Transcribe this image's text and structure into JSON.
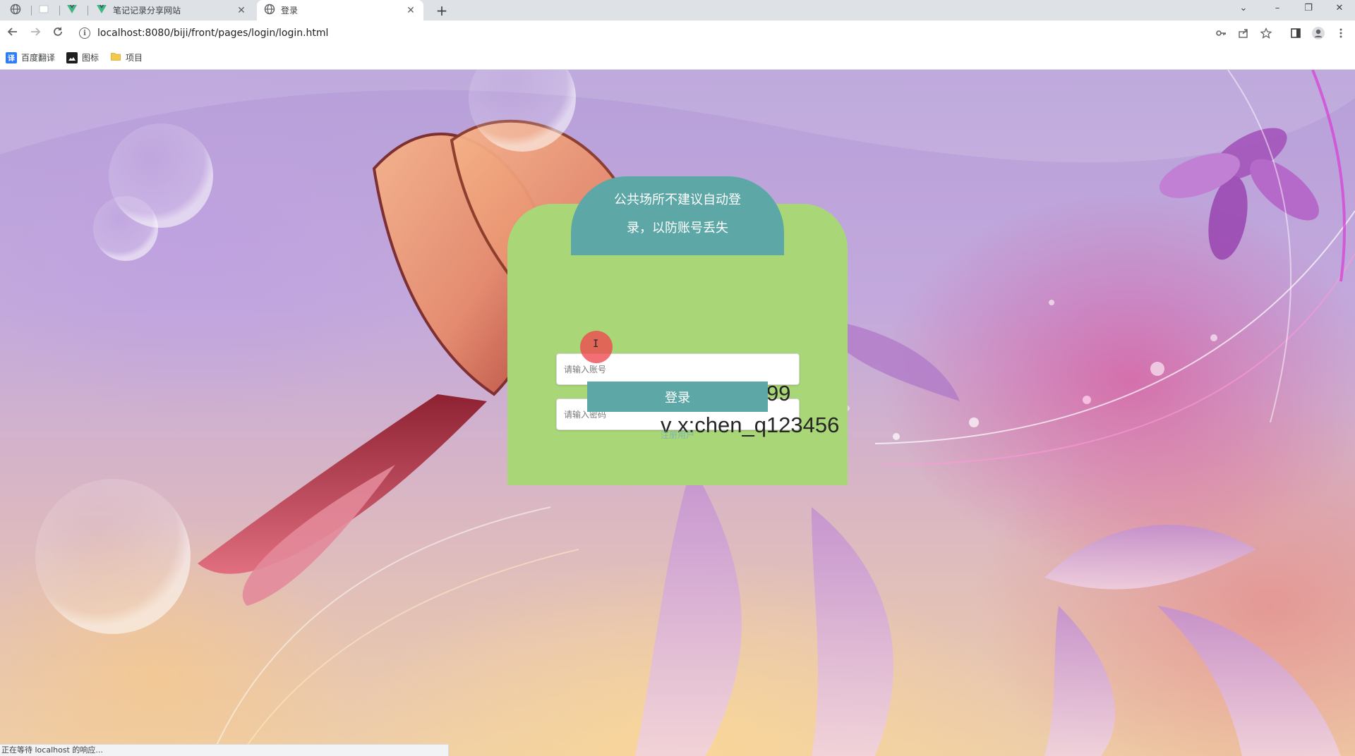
{
  "browser": {
    "tabs": [
      {
        "title": "",
        "icon": "globe-icon"
      },
      {
        "title": "",
        "icon": "blank-page-icon"
      },
      {
        "title": "",
        "icon": "vue-logo-icon"
      },
      {
        "title": "笔记记录分享网站",
        "icon": "vue-logo-icon"
      },
      {
        "title": "登录",
        "icon": "globe-icon"
      }
    ],
    "active_tab": 4,
    "new_tab_label": "+",
    "window_controls": {
      "collapse": "⌄",
      "minimize": "–",
      "restore": "❐",
      "close": "✕"
    },
    "address_bar": {
      "url": "localhost:8080/biji/front/pages/login/login.html"
    },
    "bookmarks": [
      {
        "label": "百度翻译",
        "icon": "translate-icon",
        "color": "#2f7cf6"
      },
      {
        "label": "图标",
        "icon": "image-icon",
        "color": "#1f1f1f"
      },
      {
        "label": "项目",
        "icon": "folder-icon",
        "color": "#f2c94c"
      }
    ],
    "status_text": "正在等待 localhost 的响应..."
  },
  "login": {
    "notice": "公共场所不建议自动登录，以防账号丢失",
    "account_placeholder": "请输入账号",
    "password_placeholder": "请输入密码",
    "submit_label": "登录",
    "register_label": "注册用户",
    "colors": {
      "card": "#a9d677",
      "header": "#5da8a7",
      "button": "#5da8a7"
    }
  },
  "overlay": {
    "watermark_line1": "git:chenqi199",
    "watermark_line2": "v x:chen_q123456"
  }
}
